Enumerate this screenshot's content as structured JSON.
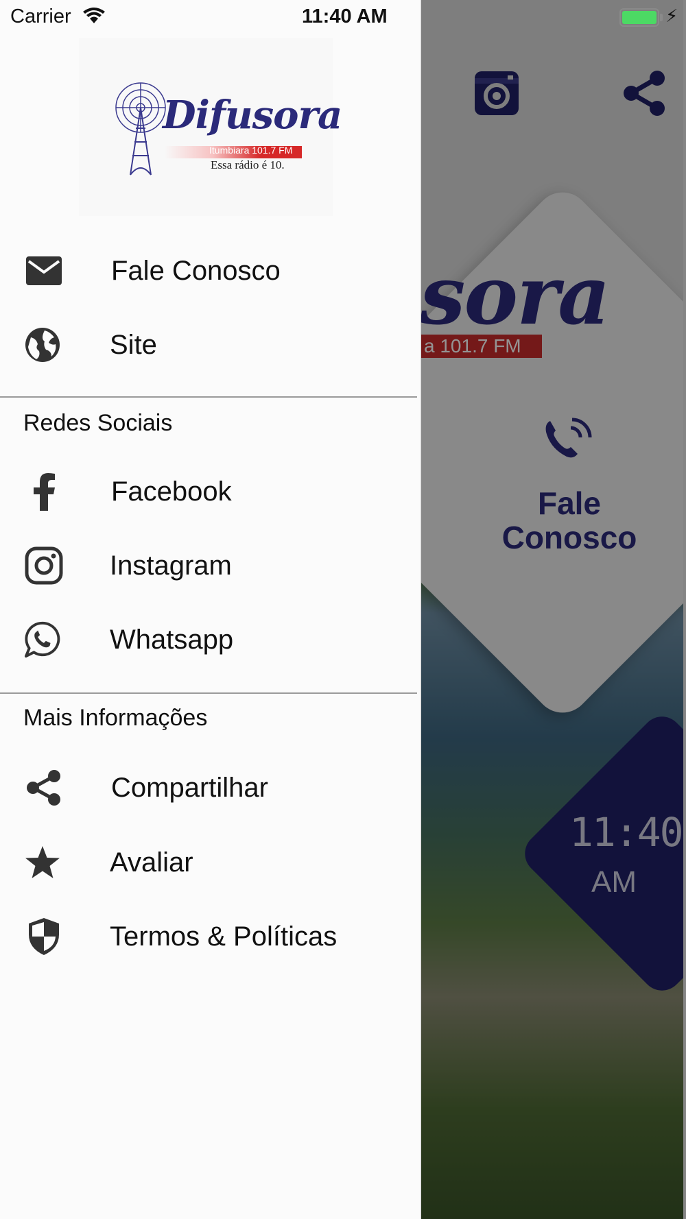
{
  "status_bar": {
    "carrier": "Carrier",
    "time": "11:40 AM"
  },
  "drawer": {
    "logo": {
      "brand": "Difusora",
      "frequency": "Itumbiara 101.7 FM",
      "tagline": "Essa rádio é 10."
    },
    "top_items": [
      {
        "label": "Fale Conosco",
        "icon": "mail-icon"
      },
      {
        "label": "Site",
        "icon": "globe-icon"
      }
    ],
    "social_section": {
      "title": "Redes Sociais",
      "items": [
        {
          "label": "Facebook",
          "icon": "facebook-icon"
        },
        {
          "label": "Instagram",
          "icon": "instagram-icon"
        },
        {
          "label": "Whatsapp",
          "icon": "whatsapp-icon"
        }
      ]
    },
    "info_section": {
      "title": "Mais Informações",
      "items": [
        {
          "label": "Compartilhar",
          "icon": "share-icon"
        },
        {
          "label": "Avaliar",
          "icon": "star-icon"
        },
        {
          "label": "Termos & Políticas",
          "icon": "shield-icon"
        }
      ]
    }
  },
  "background": {
    "logo_fragment": "sora",
    "logo_sub_fragment": "a 101.7 FM",
    "contact_card": {
      "line1": "Fale",
      "line2": "Conosco"
    },
    "clock": {
      "time": "11:40",
      "ampm": "AM"
    },
    "colors": {
      "brand_navy": "#2b2a7a",
      "clock_bg": "#1f1f66",
      "accent_red": "#c92b2b"
    }
  }
}
